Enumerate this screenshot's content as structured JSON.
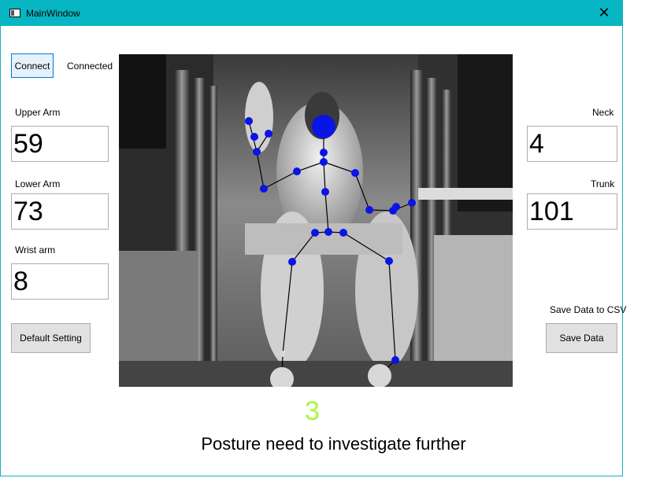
{
  "window": {
    "title": "MainWindow",
    "close_glyph": "✕"
  },
  "connection": {
    "connect_label": "Connect",
    "status": "Connected"
  },
  "angles_left": {
    "upper_arm_label": "Upper Arm",
    "upper_arm_value": "59",
    "lower_arm_label": "Lower Arm",
    "lower_arm_value": "73",
    "wrist_label": "Wrist arm",
    "wrist_value": "8"
  },
  "angles_right": {
    "neck_label": "Neck",
    "neck_value": "4",
    "trunk_label": "Trunk",
    "trunk_value": "101"
  },
  "buttons": {
    "default_setting": "Default Setting",
    "save_data": "Save Data",
    "save_csv_label": "Save Data to CSV"
  },
  "result": {
    "score": "3",
    "message": "Posture need to investigate further"
  },
  "colors": {
    "titlebar": "#07b6c3",
    "joint": "#0a14e6",
    "score": "#a9f73a"
  },
  "icons": [
    "window-app-icon",
    "close-icon"
  ]
}
